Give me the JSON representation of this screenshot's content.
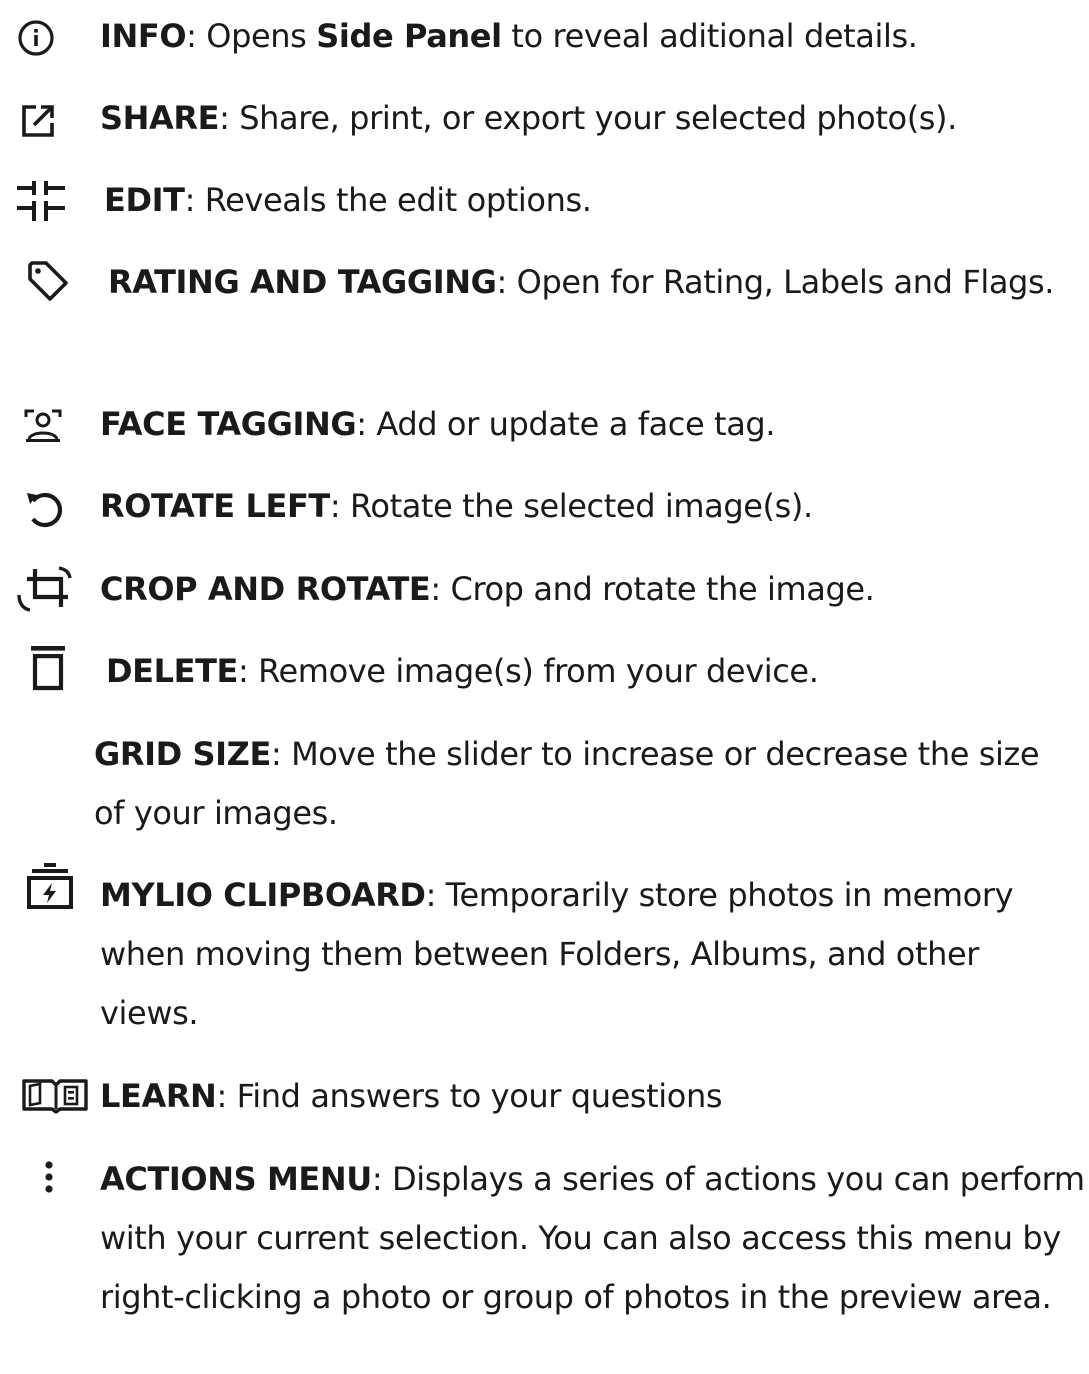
{
  "items": [
    {
      "icon": "info-icon",
      "title": "INFO",
      "pre": ": Opens ",
      "bold2": "Side Panel",
      "post": " to reveal aditional details."
    },
    {
      "icon": "share-icon",
      "title": "SHARE",
      "desc": ": Share, print, or export your selected photo(s)."
    },
    {
      "icon": "sliders-icon",
      "title": "EDIT",
      "desc": ": Reveals the edit options."
    },
    {
      "icon": "tag-icon",
      "title": "RATING AND TAGGING",
      "desc": ": Open for Rating, Labels and Flags."
    },
    {
      "icon": "face-tag-icon",
      "title": "FACE TAGGING",
      "desc": ": Add or update a face tag."
    },
    {
      "icon": "rotate-left-icon",
      "title": "ROTATE LEFT",
      "desc": ": Rotate the selected image(s)."
    },
    {
      "icon": "crop-rotate-icon",
      "title": "CROP AND ROTATE",
      "desc": ": Crop and rotate the image."
    },
    {
      "icon": "trash-icon",
      "title": "DELETE",
      "desc": ": Remove image(s) from your device."
    },
    {
      "icon": "",
      "title": "GRID SIZE",
      "desc": ": Move the slider to increase or decrease the size of your images."
    },
    {
      "icon": "clipboard-icon",
      "title": "MYLIO CLIPBOARD",
      "desc": ": Temporarily store photos in memory when moving them between Folders, Albums, and other views."
    },
    {
      "icon": "book-icon",
      "title": "LEARN",
      "desc": ": Find answers to your questions"
    },
    {
      "icon": "more-vertical-icon",
      "title": "ACTIONS MENU",
      "desc": ": Displays a series of actions you can perform with your current selection. You can also access this menu by right-clicking a photo or group of photos in the preview area."
    }
  ]
}
